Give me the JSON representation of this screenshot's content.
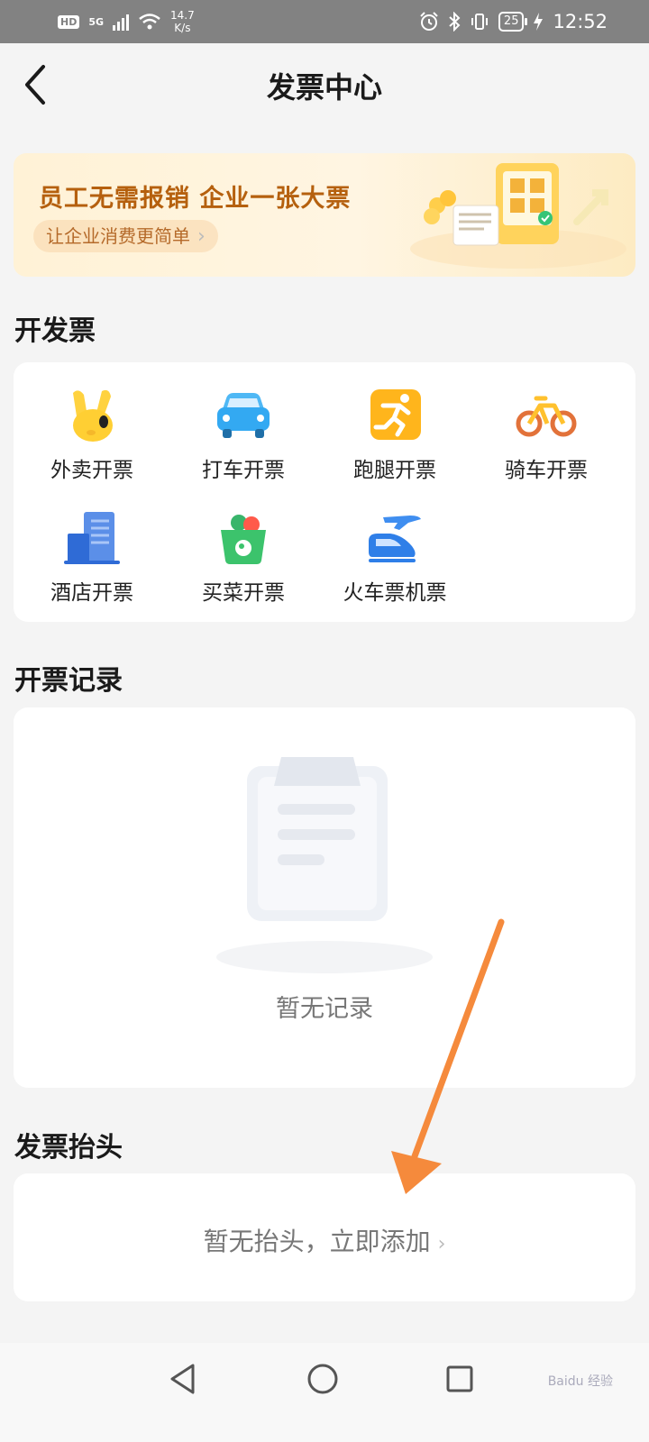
{
  "status_bar": {
    "hd": "HD",
    "network": "5G",
    "speed_value": "14.7",
    "speed_unit": "K/s",
    "battery": "25",
    "time": "12:52",
    "icons": [
      "hd-icon",
      "signal-icon",
      "wifi-icon",
      "alarm-icon",
      "bluetooth-icon",
      "vibrate-icon",
      "battery-icon",
      "charging-icon"
    ]
  },
  "header": {
    "title": "发票中心",
    "back_icon": "chevron-left-icon"
  },
  "banner": {
    "title": "员工无需报销 企业一张大票",
    "subtitle": "让企业消费更简单"
  },
  "issue_section": {
    "title": "开发票",
    "items": [
      {
        "label": "外卖开票",
        "icon": "rabbit-ears-icon"
      },
      {
        "label": "打车开票",
        "icon": "car-icon"
      },
      {
        "label": "跑腿开票",
        "icon": "runner-icon"
      },
      {
        "label": "骑车开票",
        "icon": "bicycle-icon"
      },
      {
        "label": "酒店开票",
        "icon": "hotel-icon"
      },
      {
        "label": "买菜开票",
        "icon": "grocery-basket-icon"
      },
      {
        "label": "火车票机票",
        "icon": "train-plane-icon"
      }
    ]
  },
  "records_section": {
    "title": "开票记录",
    "empty_text": "暂无记录",
    "empty_icon": "clipboard-icon"
  },
  "header_section": {
    "title": "发票抬头",
    "add_text": "暂无抬头，立即添加"
  },
  "nav_bar": {
    "icons": [
      "back-triangle-icon",
      "home-circle-icon",
      "recents-square-icon"
    ]
  },
  "watermark": "Baidu 经验"
}
